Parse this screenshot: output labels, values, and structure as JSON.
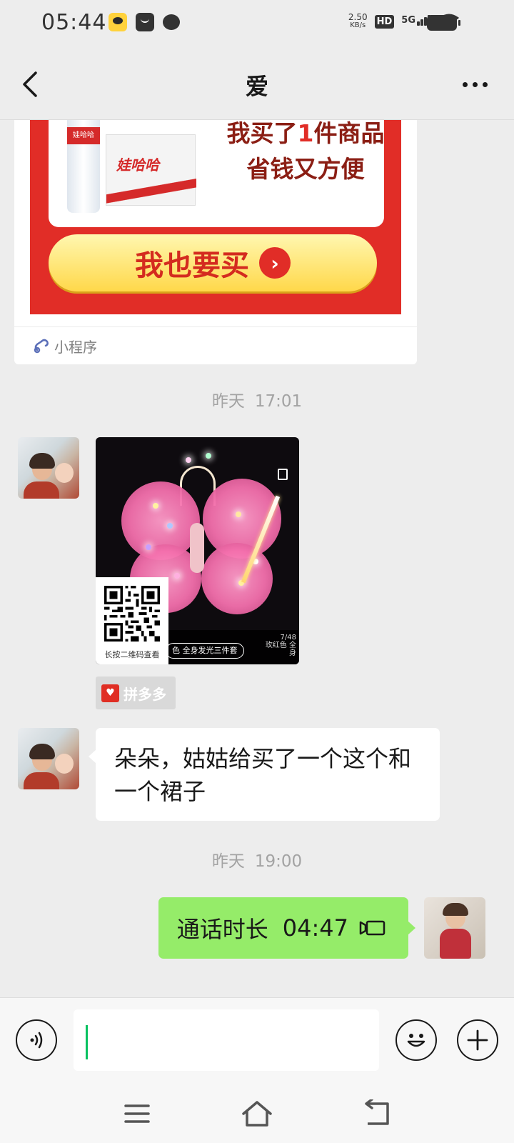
{
  "status_bar": {
    "time": "05:44",
    "net_speed_value": "2.50",
    "net_speed_unit": "KB/s",
    "hd_label": "HD",
    "network_label": "5G"
  },
  "header": {
    "title": "爱"
  },
  "mini_program_card": {
    "bottle_label": "娃哈哈",
    "box_label": "娃哈哈",
    "promo_line1_prefix": "我买了",
    "promo_line1_count": "1",
    "promo_line1_suffix": "件商品",
    "promo_line2": "省钱又方便",
    "cta_label": "我也要买",
    "footer_label": "小程序"
  },
  "timestamps": [
    {
      "day": "昨天",
      "time": "17:01"
    },
    {
      "day": "昨天",
      "time": "19:00"
    }
  ],
  "product_card": {
    "qr_caption": "长按二维码查看",
    "tag_text": "色 全身发光三件套",
    "image_counter": "7/48",
    "image_sub": "玫红色 全身"
  },
  "source_badge": {
    "label": "拼多多"
  },
  "messages": [
    {
      "side": "left",
      "text": "朵朵，姑姑给买了一个这个和一个裙子"
    },
    {
      "side": "right",
      "type": "call",
      "label": "通话时长",
      "duration": "04:47"
    }
  ],
  "input": {
    "value": "",
    "placeholder": ""
  },
  "icons": {
    "back": "chevron-left-icon",
    "more": "more-dots-icon",
    "voice": "voice-icon",
    "emoji": "emoji-icon",
    "plus": "plus-icon",
    "call": "phone-call-icon"
  },
  "colors": {
    "background": "#ededed",
    "sent_bubble": "#95ec69",
    "received_bubble": "#ffffff",
    "accent_green": "#07c160",
    "promo_red": "#e12d27",
    "pdd_red": "#e02e24"
  }
}
